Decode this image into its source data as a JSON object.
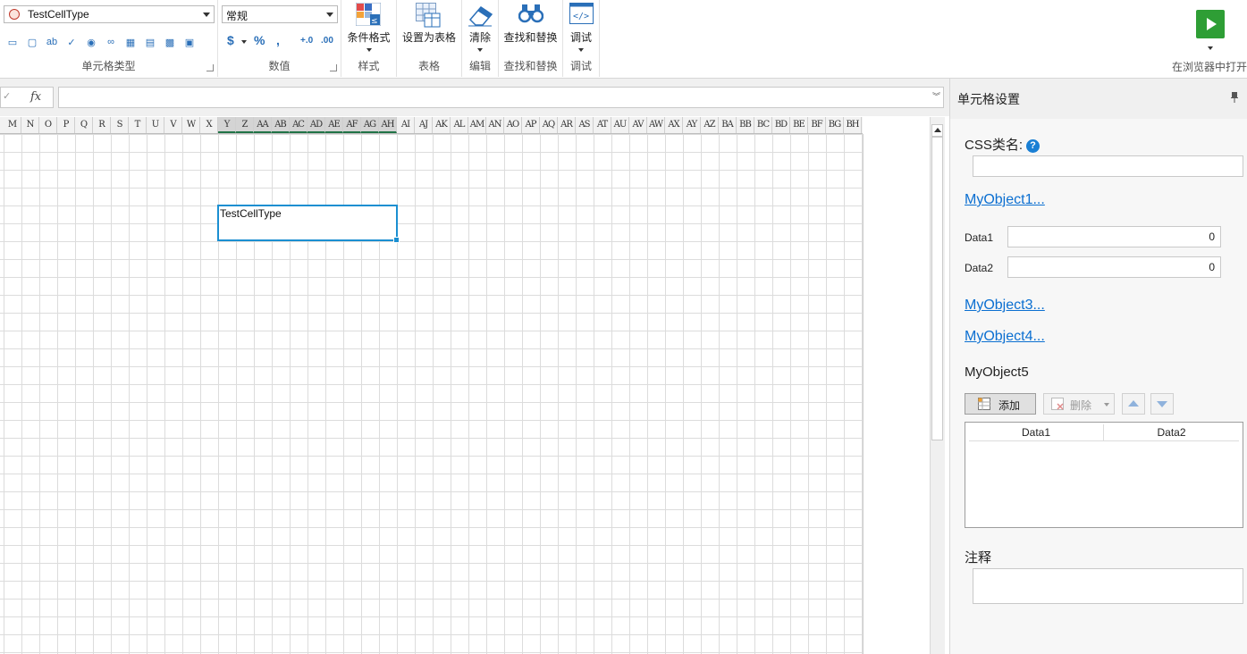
{
  "ribbon": {
    "celltype_group": {
      "combo_value": "TestCellType",
      "label": "单元格类型",
      "icons": [
        "textbox-icon",
        "button-icon",
        "label-icon",
        "checkbox-icon",
        "radio-icon",
        "hyperlink-icon",
        "form-icon",
        "listview-icon",
        "table-icon",
        "image-icon"
      ]
    },
    "number_group": {
      "combo_value": "常规",
      "label": "数值",
      "currency": "$",
      "percent": "%",
      "comma": ",",
      "increase_decimal": "+.0",
      "decrease_decimal": ".00"
    },
    "style_group": {
      "button": "条件格式",
      "label": "样式"
    },
    "table_group": {
      "button": "设置为表格",
      "label": "表格"
    },
    "edit_group": {
      "button": "清除",
      "label": "编辑"
    },
    "find_group": {
      "button": "查找和替换",
      "label": "查找和替换"
    },
    "debug_group": {
      "button": "调试",
      "label": "调试"
    },
    "run": {
      "label": "在浏览器中打开"
    }
  },
  "formula_bar": {
    "fx_label": "fx",
    "value": ""
  },
  "sheet": {
    "columns": [
      "M",
      "N",
      "O",
      "P",
      "Q",
      "R",
      "S",
      "T",
      "U",
      "V",
      "W",
      "X",
      "Y",
      "Z",
      "AA",
      "AB",
      "AC",
      "AD",
      "AE",
      "AF",
      "AG",
      "AH",
      "AI",
      "AJ",
      "AK",
      "AL",
      "AM",
      "AN",
      "AO",
      "AP",
      "AQ",
      "AR",
      "AS",
      "AT",
      "AU",
      "AV",
      "AW",
      "AX",
      "AY",
      "AZ",
      "BA",
      "BB",
      "BC",
      "BD",
      "BE",
      "BF",
      "BG",
      "BH"
    ],
    "selected_columns": [
      "Y",
      "Z",
      "AA",
      "AB",
      "AC",
      "AD",
      "AE",
      "AF",
      "AG",
      "AH"
    ],
    "selected_cell_text": "TestCellType"
  },
  "panel": {
    "title": "单元格设置",
    "css_label": "CSS类名:",
    "css_value": "",
    "help_glyph": "?",
    "object1_link": "MyObject1...",
    "data1_label": "Data1",
    "data1_value": "0",
    "data2_label": "Data2",
    "data2_value": "0",
    "object3_link": "MyObject3...",
    "object4_link": "MyObject4...",
    "object5_label": "MyObject5",
    "add_button": "添加",
    "delete_button": "删除",
    "table_headers": [
      "Data1",
      "Data2"
    ],
    "note_label": "注释",
    "note_value": ""
  },
  "colors": {
    "selection": "#1b8fd1",
    "link": "#0b6fd1",
    "run_button": "#2e9e35",
    "help_icon": "#1a7fd4"
  }
}
